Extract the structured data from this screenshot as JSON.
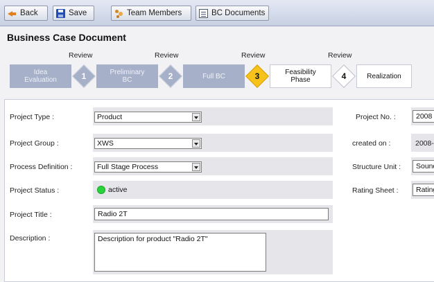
{
  "toolbar": {
    "back_label": "Back",
    "save_label": "Save",
    "team_label": "Team Members",
    "docs_label": "BC Documents"
  },
  "header": {
    "title": "Business Case Document"
  },
  "process": {
    "review_label": "Review",
    "stages": [
      {
        "line1": "Idea",
        "line2": "Evaluation",
        "state": "past"
      },
      {
        "line1": "Preliminary",
        "line2": "BC",
        "state": "past"
      },
      {
        "line1": "Full BC",
        "line2": "",
        "state": "past"
      },
      {
        "line1": "Feasibility",
        "line2": "Phase",
        "state": "current"
      },
      {
        "line1": "Realization",
        "line2": "",
        "state": "future"
      }
    ],
    "gates": [
      "1",
      "2",
      "3",
      "4"
    ],
    "current_gate_color": "#f7c21a",
    "past_color": "#a6b0c8"
  },
  "form": {
    "project_type": {
      "label": "Project Type :",
      "value": "Product"
    },
    "project_group": {
      "label": "Project Group :",
      "value": "XWS"
    },
    "process_definition": {
      "label": "Process Definition :",
      "value": "Full Stage Process"
    },
    "project_status": {
      "label": "Project Status :",
      "value": "active",
      "status_color": "#27d43a"
    },
    "project_title": {
      "label": "Project Title :",
      "value": "Radio 2T"
    },
    "description": {
      "label": "Description :",
      "value": "Description for product \"Radio 2T\""
    },
    "project_no": {
      "label": "Project No. :",
      "value": "2008"
    },
    "created_on": {
      "label": "created on :",
      "value": "2008-"
    },
    "structure_unit": {
      "label": "Structure Unit :",
      "value": "Sound"
    },
    "rating_sheet": {
      "label": "Rating Sheet :",
      "value": "Rating"
    }
  }
}
